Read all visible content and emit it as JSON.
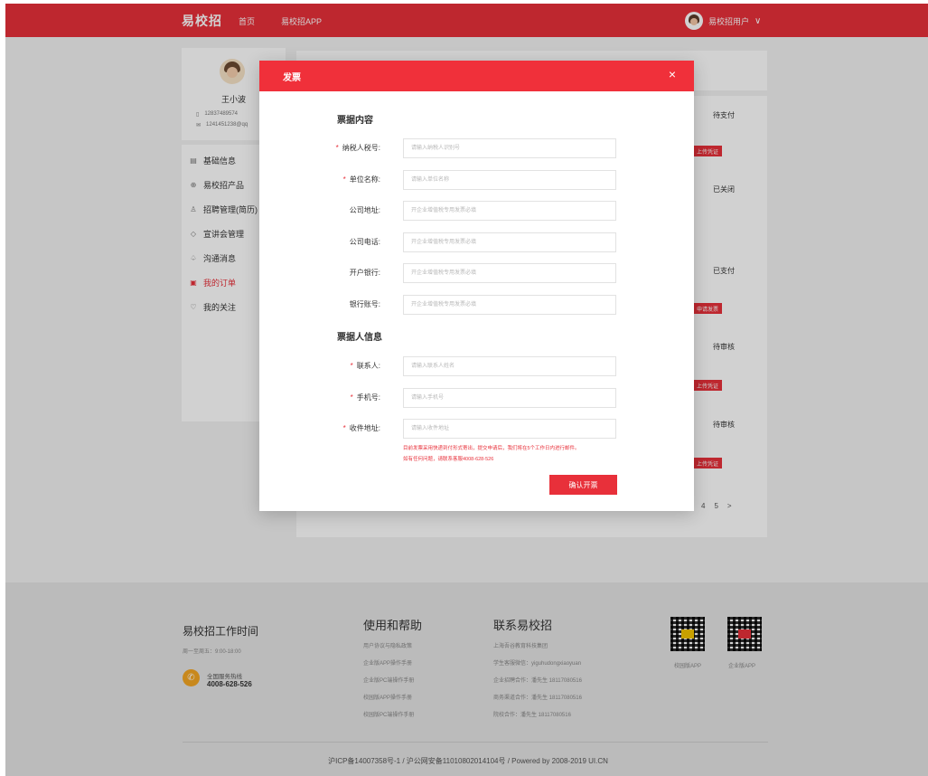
{
  "header": {
    "logo": "易校招",
    "nav": [
      "首页",
      "易校招APP"
    ],
    "user_name": "易校招用户",
    "chevron": "∨"
  },
  "profile": {
    "name": "王小波",
    "phone": "12837489574",
    "email": "1241451238@qq"
  },
  "menu": {
    "items": [
      {
        "icon": "▤",
        "label": "基础信息"
      },
      {
        "icon": "⊕",
        "label": "易校招产品"
      },
      {
        "icon": "♙",
        "label": "招聘管理(简历)"
      },
      {
        "icon": "◇",
        "label": "宣讲会管理"
      },
      {
        "icon": "♤",
        "label": "沟通消息"
      },
      {
        "icon": "▣",
        "label": "我的订单"
      },
      {
        "icon": "♡",
        "label": "我的关注"
      }
    ],
    "active_index": 5
  },
  "orders": {
    "statuses": [
      "待支付",
      "已关闭",
      "已支付",
      "待审核",
      "待审核"
    ],
    "buttons": [
      "上传凭证",
      "申请发票",
      "上传凭证",
      "上传凭证"
    ],
    "pager": [
      "4",
      "5",
      ">"
    ]
  },
  "modal": {
    "title": "发票",
    "close": "×",
    "section1_title": "票据内容",
    "section2_title": "票据人信息",
    "fields": [
      {
        "label": "纳税人税号:",
        "required": true,
        "placeholder": "请输入纳税人识别号"
      },
      {
        "label": "单位名称:",
        "required": true,
        "placeholder": "请输入单位名称"
      },
      {
        "label": "公司地址:",
        "required": false,
        "placeholder": "开企业增值税专用发票必填"
      },
      {
        "label": "公司电话:",
        "required": false,
        "placeholder": "开企业增值税专用发票必填"
      },
      {
        "label": "开户银行:",
        "required": false,
        "placeholder": "开企业增值税专用发票必填"
      },
      {
        "label": "银行账号:",
        "required": false,
        "placeholder": "开企业增值税专用发票必填"
      },
      {
        "label": "联系人:",
        "required": true,
        "placeholder": "请输入联系人姓名"
      },
      {
        "label": "手机号:",
        "required": true,
        "placeholder": "请输入手机号"
      },
      {
        "label": "收件地址:",
        "required": true,
        "placeholder": "请输入收件地址"
      }
    ],
    "notice_line1": "目前发票采用快递到付形式寄出，提交申请后，我们将在5个工作日内进行邮件。",
    "notice_line2": "如有任何问题，请联系客服4008-628-526",
    "confirm_label": "确认开票"
  },
  "footer": {
    "worktime_title": "易校招工作时间",
    "worktime": "周一至周五：9:00-18:00",
    "hotline_label": "全国服务热线",
    "hotline": "4008-628-526",
    "help_title": "使用和帮助",
    "help_links": [
      "用户协议与隐私政策",
      "企业版APP操作手册",
      "企业版PC端操作手册",
      "校园版APP操作手册",
      "校园版PC端操作手册"
    ],
    "contact_title": "联系易校招",
    "contact_links": [
      "上海吾谷教育科技集团",
      "学生客服微信：yiguhudongxiaoyuan",
      "企业招聘合作：潘先生 18117080516",
      "商务渠道合作：潘先生 18117080516",
      "院校合作：潘先生 18117080516"
    ],
    "qr1_label": "校园版APP",
    "qr2_label": "企业版APP",
    "copyright": "沪ICP备14007358号-1 / 沪公网安备11010802014104号 / Powered by 2008-2019 UI.CN"
  },
  "colors": {
    "brand": "#e8303a",
    "footer_bg": "#e4e4e4"
  }
}
